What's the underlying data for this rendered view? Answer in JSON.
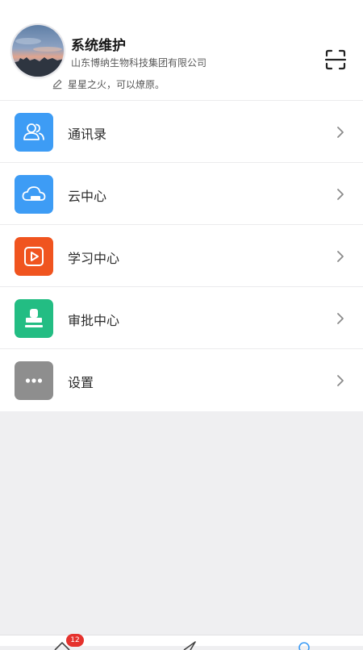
{
  "profile": {
    "name": "系统维护",
    "company": "山东博纳生物科技集团有限公司",
    "signature": "星星之火，可以燎原。",
    "avatar_icon": "avatar-sky-photo",
    "scan_icon": "scan-icon",
    "edit_icon": "pencil-icon"
  },
  "menu": {
    "items": [
      {
        "label": "通讯录",
        "icon": "contacts-icon",
        "color": "#3d9cf5"
      },
      {
        "label": "云中心",
        "icon": "cloud-icon",
        "color": "#3d9cf5"
      },
      {
        "label": "学习中心",
        "icon": "play-icon",
        "color": "#f0541f"
      },
      {
        "label": "审批中心",
        "icon": "stamp-icon",
        "color": "#23bd83"
      },
      {
        "label": "设置",
        "icon": "more-icon",
        "color": "#8e8e8e"
      }
    ]
  },
  "tabbar": {
    "badge_count": "12",
    "tabs": [
      {
        "icon": "home-icon"
      },
      {
        "icon": "send-icon"
      },
      {
        "icon": "profile-icon"
      }
    ]
  }
}
